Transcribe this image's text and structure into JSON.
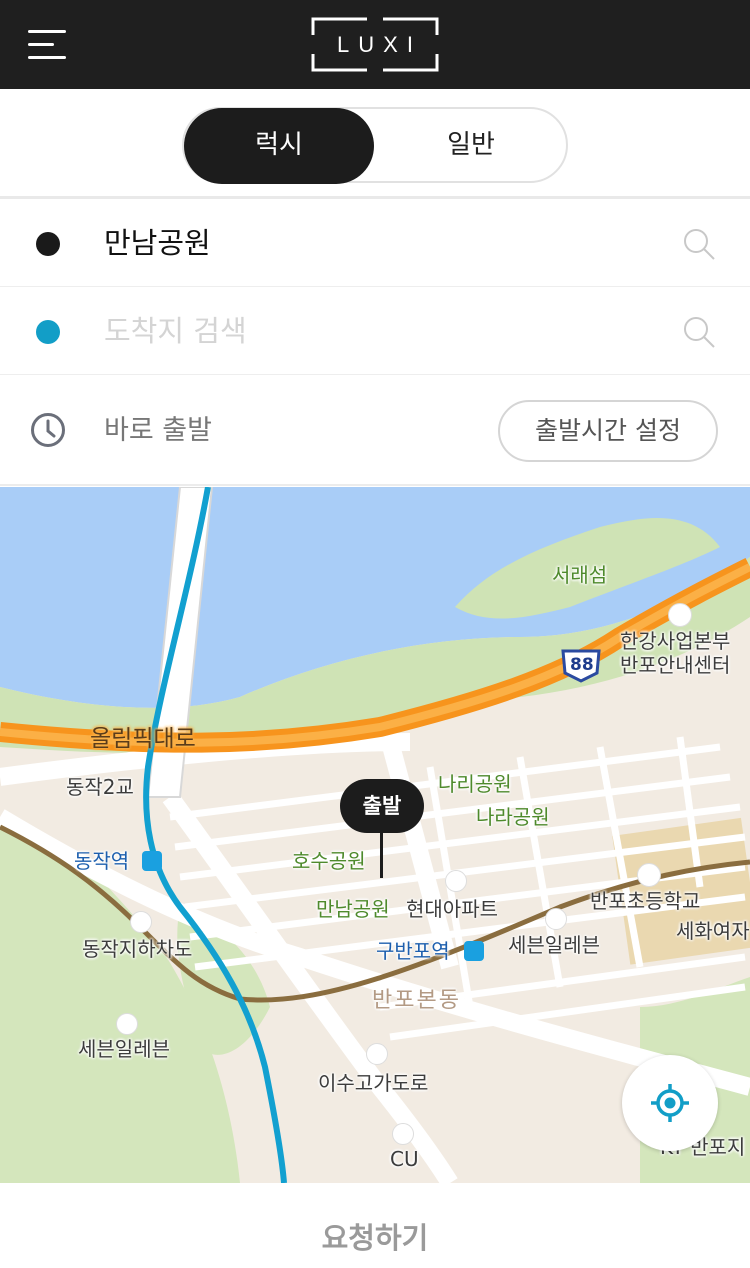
{
  "header": {
    "logo_text": "LUXI",
    "menu_icon": "hamburger-menu-icon"
  },
  "ride_type": {
    "options": [
      "럭시",
      "일반"
    ],
    "selected": "럭시"
  },
  "origin": {
    "value": "만남공원",
    "icon": "search-icon"
  },
  "destination": {
    "placeholder": "도착지 검색",
    "icon": "search-icon"
  },
  "departure": {
    "label": "바로 출발",
    "set_time_button": "출발시간 설정",
    "icon": "clock-icon"
  },
  "map": {
    "pin_label": "출발",
    "labels": {
      "island": "서래섬",
      "hq1": "한강사업본부",
      "hq2": "반포안내센터",
      "route_number": "88",
      "olympic_road": "올림픽대로",
      "dongjak_bridge": "동작2교",
      "nari_park": "나리공원",
      "nara_park": "나라공원",
      "dongjak_station": "동작역",
      "hosu_park": "호수공원",
      "mannam_park": "만남공원",
      "hyundai_apt": "현대아파트",
      "banpo_school": "반포초등학교",
      "sehwa": "세화여자",
      "dongjak_underpass": "동작지하차도",
      "gubanpo_station": "구반포역",
      "seven_eleven_1": "세븐일레븐",
      "banpo_bondong": "반포본동",
      "seven_eleven_2": "세븐일레븐",
      "isu_overpass": "이수고가도로",
      "cu": "CU",
      "kt_banpo": "KT 반포지"
    },
    "locate_icon": "my-location-icon"
  },
  "request_button": "요청하기",
  "colors": {
    "header_bg": "#1f1f1f",
    "toggle_active": "#1c1c1c",
    "destination_dot": "#129ec7",
    "route_line": "#12a0d0",
    "expressway": "#f7941d",
    "river": "#a9cdf7",
    "park": "#cfe3b5"
  }
}
